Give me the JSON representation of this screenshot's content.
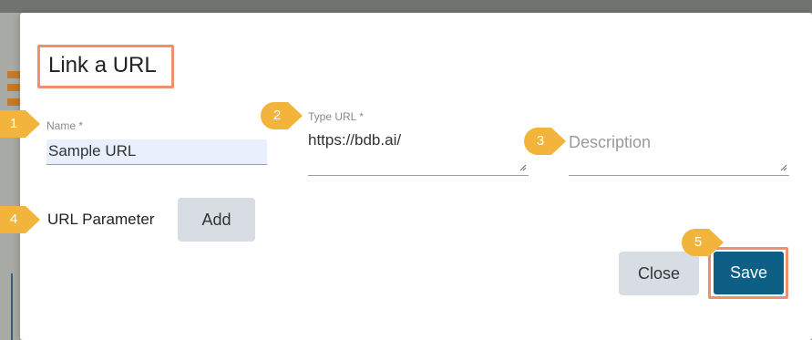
{
  "dialog": {
    "title": "Link a URL",
    "name_field": {
      "label": "Name *",
      "value": "Sample URL"
    },
    "type_url_field": {
      "label": "Type URL *",
      "value": "https://bdb.ai/"
    },
    "description_field": {
      "placeholder": "Description"
    },
    "url_parameter_label": "URL Parameter",
    "add_button": "Add",
    "close_button": "Close",
    "save_button": "Save"
  },
  "steps": [
    "1",
    "2",
    "3",
    "4",
    "5"
  ],
  "colors": {
    "highlight": "#ee8f6d",
    "badge": "#f2b43a",
    "save_button": "#0d5f86",
    "grey_button": "#d8dde3"
  }
}
